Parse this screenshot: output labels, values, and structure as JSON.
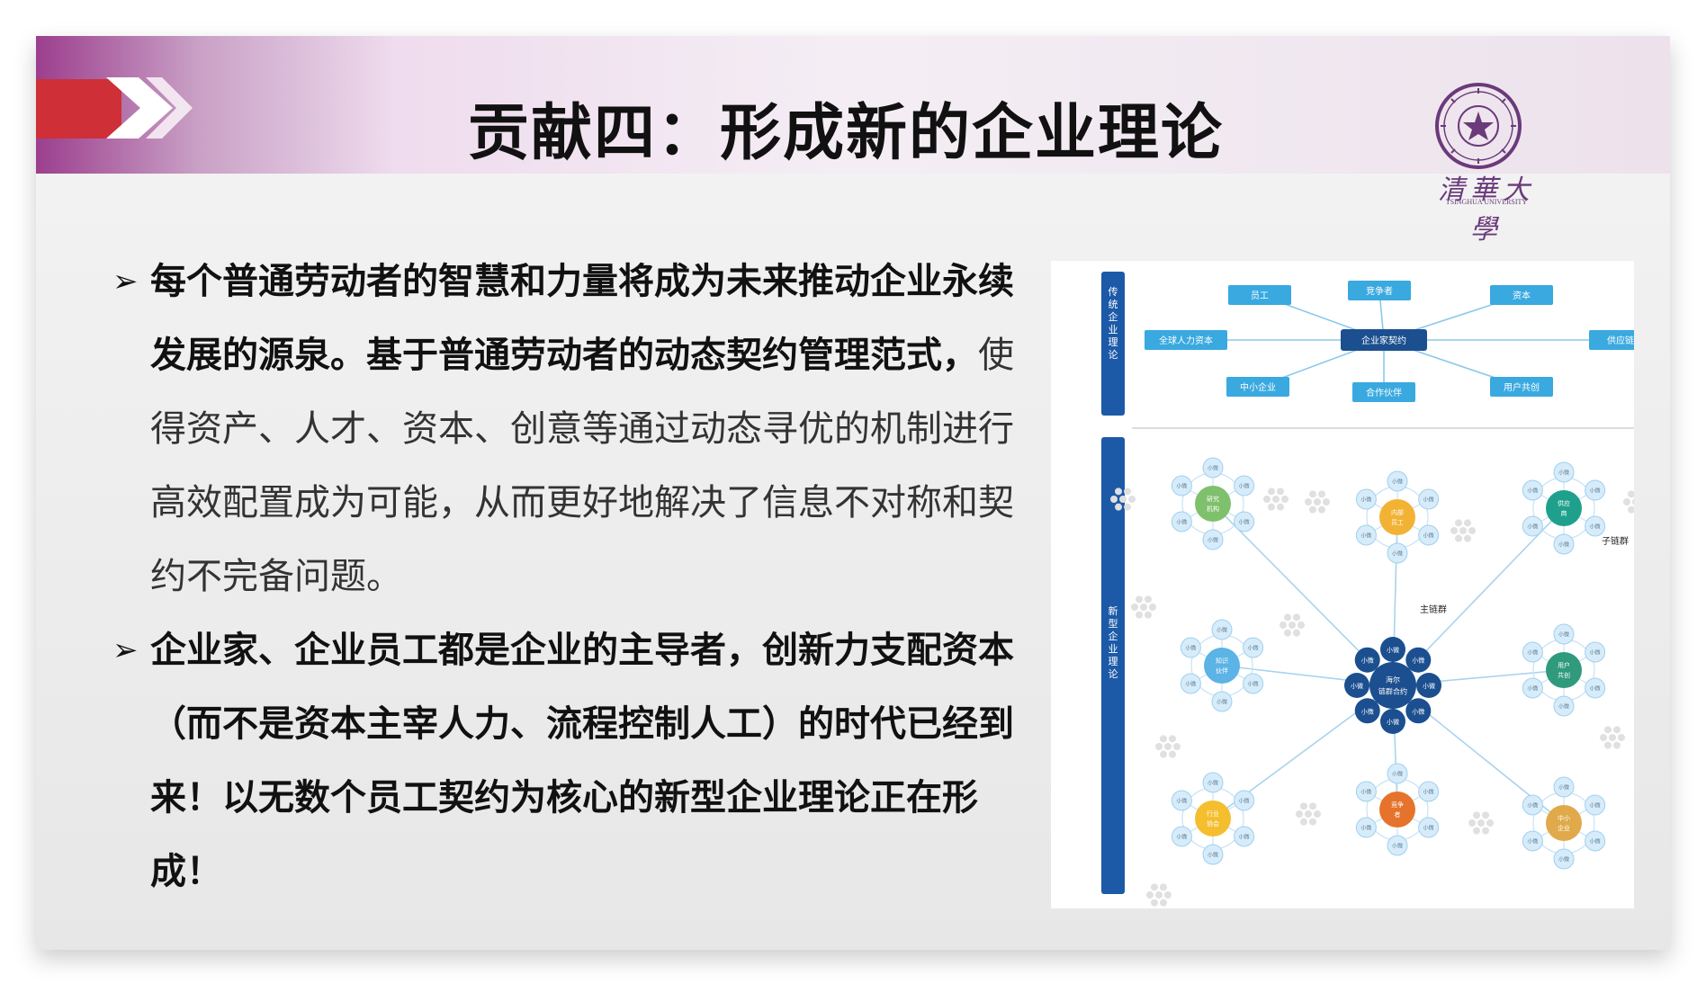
{
  "slide": {
    "title": "贡献四：形成新的企业理论",
    "logo": {
      "name_text": "清華大學",
      "sub_text": "TSINGHUA UNIVERSITY"
    },
    "bullets": [
      {
        "bold": "每个普通劳动者的智慧和力量将成为未来推动企业永续发展的源泉。基于普通劳动者的动态契约管理范式，",
        "normal": "使得资产、人才、资本、创意等通过动态寻优的机制进行高效配置成为可能，从而更好地解决了信息不对称和契约不完备问题。"
      },
      {
        "bold": "企业家、企业员工都是企业的主导者，创新力支配资本（而不是资本主宰人力、流程控制人工）的时代已经到来！以无数个员工契约为核心的新型企业理论正在形成！",
        "normal": ""
      }
    ]
  },
  "diagram": {
    "sections": [
      "传统企业理论",
      "新型企业理论"
    ],
    "traditional": {
      "center": "企业家契约",
      "nodes": [
        "员工",
        "竞争者",
        "资本",
        "全球人力资本",
        "供应链",
        "中小企业",
        "合作伙伴",
        "用户共创"
      ]
    },
    "new": {
      "center": "海尔链群合约",
      "center_ring": [
        "小微",
        "小微",
        "小微",
        "小微",
        "小微",
        "小微",
        "小微",
        "小微"
      ],
      "main_label": "主链群",
      "sub_label": "子链群",
      "clusters": [
        "研究机构",
        "内部员工",
        "供应商",
        "知识伙伴",
        "用户共创",
        "行业协会",
        "竞争者",
        "中小企业"
      ],
      "ring_label": "小微"
    },
    "colors": {
      "bar": "#1c5aa8",
      "trad_node": "#39a9e0",
      "center": "#1b4f8f",
      "ring": "#9fd0ef",
      "cluster_colors": [
        "#7fc06c",
        "#f2b233",
        "#1fa08c",
        "#5bb3e6",
        "#2f9a7c",
        "#f4be2e",
        "#e6732b",
        "#e0aa4a"
      ]
    }
  }
}
